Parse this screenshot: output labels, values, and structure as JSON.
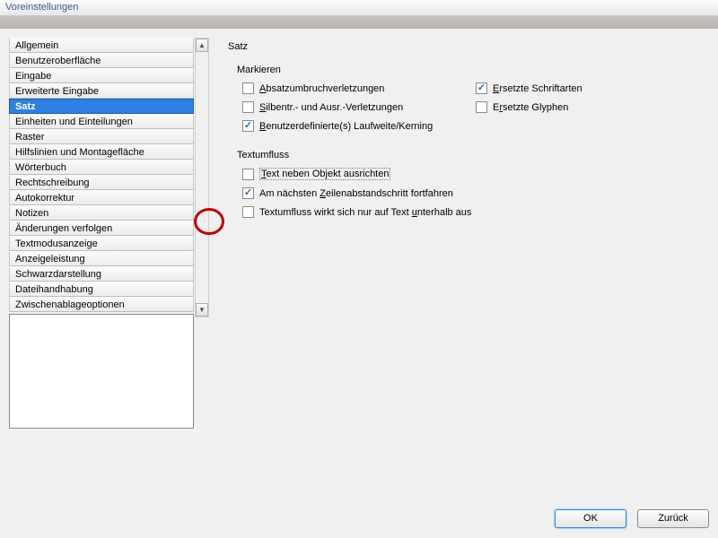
{
  "title": "Voreinstellungen",
  "sidebar": {
    "items": [
      {
        "label": "Allgemein"
      },
      {
        "label": "Benutzeroberfläche"
      },
      {
        "label": "Eingabe"
      },
      {
        "label": "Erweiterte Eingabe"
      },
      {
        "label": "Satz"
      },
      {
        "label": "Einheiten und Einteilungen"
      },
      {
        "label": "Raster"
      },
      {
        "label": "Hilfslinien und Montagefläche"
      },
      {
        "label": "Wörterbuch"
      },
      {
        "label": "Rechtschreibung"
      },
      {
        "label": "Autokorrektur"
      },
      {
        "label": "Notizen"
      },
      {
        "label": "Änderungen verfolgen"
      },
      {
        "label": "Textmodusanzeige"
      },
      {
        "label": "Anzeigeleistung"
      },
      {
        "label": "Schwarzdarstellung"
      },
      {
        "label": "Dateihandhabung"
      },
      {
        "label": "Zwischenablageoptionen"
      }
    ],
    "selected_index": 4
  },
  "panel": {
    "title": "Satz",
    "groups": {
      "markieren": {
        "title": "Markieren",
        "options": {
          "absatzumbruch": {
            "label": "Absatzumbruchverletzungen",
            "checked": false
          },
          "ersetzte_schriftarten": {
            "label": "Ersetzte Schriftarten",
            "checked": true
          },
          "silbentr": {
            "label": "Silbentr.- und Ausr.-Verletzungen",
            "checked": false
          },
          "ersetzte_glyphen": {
            "label": "Ersetzte Glyphen",
            "checked": false
          },
          "laufweite": {
            "label": "Benutzerdefinierte(s) Laufweite/Kerning",
            "checked": true
          }
        }
      },
      "textumfluss": {
        "title": "Textumfluss",
        "options": {
          "neben_objekt": {
            "label": "Text neben Objekt ausrichten",
            "checked": false
          },
          "zeilenabstand": {
            "label": "Am nächsten Zeilenabstandschritt fortfahren",
            "checked": true
          },
          "unterhalb": {
            "label": "Textumfluss wirkt sich nur auf Text unterhalb aus",
            "checked": false
          }
        }
      }
    }
  },
  "buttons": {
    "ok": "OK",
    "back": "Zurück"
  }
}
